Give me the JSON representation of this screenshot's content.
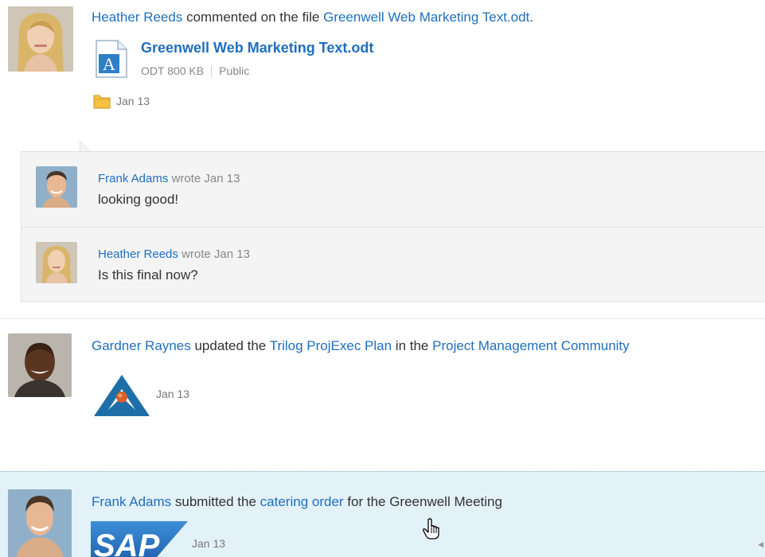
{
  "feed": {
    "items": [
      {
        "actor": "Heather Reeds",
        "action": " commented on the file ",
        "target": "Greenwell Web Marketing Text.odt",
        "target_suffix": ".",
        "file": {
          "title": "Greenwell Web Marketing Text.odt",
          "type_size": "ODT 800 KB",
          "visibility": "Public",
          "icon": "document-icon",
          "icon_letter": "A"
        },
        "date": "Jan 13",
        "comments": [
          {
            "author": "Frank Adams",
            "wrote": "wrote Jan 13",
            "text": "looking good!"
          },
          {
            "author": "Heather Reeds",
            "wrote": "wrote Jan 13",
            "text": "Is this final now?"
          }
        ]
      },
      {
        "actor": "Gardner Raynes",
        "action": " updated the ",
        "target": "Trilog ProjExec Plan",
        "middle": " in the ",
        "container": "Project Management Community",
        "date": "Jan 13",
        "icon": "projexec-logo-icon"
      },
      {
        "actor": "Frank Adams",
        "action": " submitted the ",
        "target": "catering order",
        "suffix": " for the Greenwell Meeting",
        "date": "Jan 13",
        "logo_text": "SAP",
        "icon": "sap-logo-icon"
      }
    ]
  },
  "colors": {
    "link": "#1f6fbf",
    "highlight_row": "#e3f1f8",
    "comment_bg": "#f4f4f4"
  }
}
